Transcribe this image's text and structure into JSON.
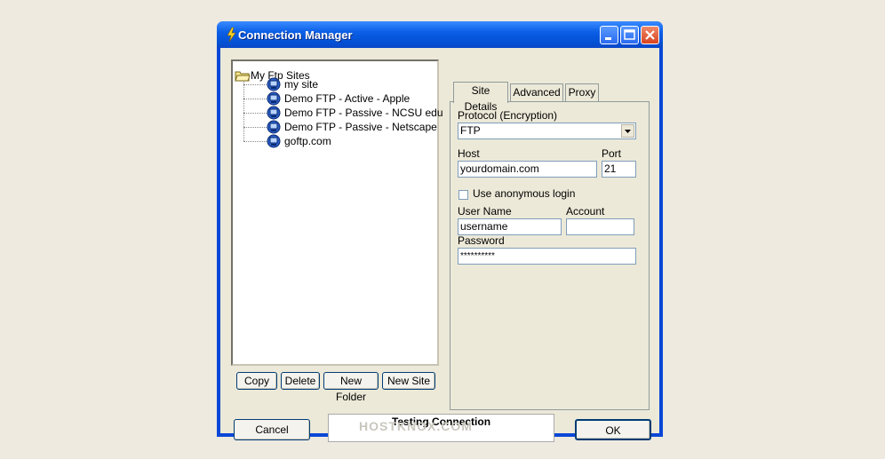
{
  "window": {
    "title": "Connection Manager"
  },
  "tree": {
    "root": "My Ftp Sites",
    "sites": [
      "my site",
      "Demo FTP - Active - Apple",
      "Demo FTP - Passive - NCSU edu",
      "Demo FTP - Passive - Netscape",
      "goftp.com"
    ]
  },
  "tree_buttons": {
    "copy": "Copy",
    "delete": "Delete",
    "new_folder": "New Folder",
    "new_site": "New Site"
  },
  "tabs": [
    "Site Details",
    "Advanced",
    "Proxy"
  ],
  "form": {
    "protocol_label": "Protocol (Encryption)",
    "protocol_value": "FTP",
    "host_label": "Host",
    "host_value": "yourdomain.com",
    "port_label": "Port",
    "port_value": "21",
    "anonymous_label": "Use anonymous login",
    "username_label": "User Name",
    "username_value": "username",
    "account_label": "Account",
    "account_value": "",
    "password_label": "Password",
    "password_value": "**********"
  },
  "footer": {
    "cancel": "Cancel",
    "status": "Testing Connection",
    "ok": "OK"
  },
  "watermark": "HOSTKNOX.COM"
}
